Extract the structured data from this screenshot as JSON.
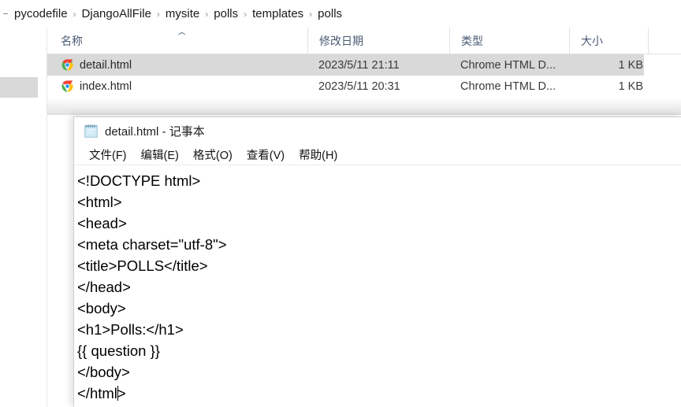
{
  "explorer": {
    "breadcrumb": {
      "separator": "›",
      "items": [
        {
          "label": "pycodefile"
        },
        {
          "label": "DjangoAllFile"
        },
        {
          "label": "mysite"
        },
        {
          "label": "polls"
        },
        {
          "label": "templates"
        },
        {
          "label": "polls"
        }
      ]
    },
    "columns": [
      {
        "key": "name",
        "label": "名称",
        "sort_indicator": "^"
      },
      {
        "key": "date",
        "label": "修改日期"
      },
      {
        "key": "type",
        "label": "类型"
      },
      {
        "key": "size",
        "label": "大小"
      }
    ],
    "files": [
      {
        "icon": "chrome-icon",
        "name": "detail.html",
        "date": "2023/5/11 21:11",
        "type": "Chrome HTML D...",
        "size": "1 KB",
        "selected": true
      },
      {
        "icon": "chrome-icon",
        "name": "index.html",
        "date": "2023/5/11 20:31",
        "type": "Chrome HTML D...",
        "size": "1 KB",
        "selected": false
      }
    ]
  },
  "notepad": {
    "icon": "notepad-icon",
    "title": "detail.html - 记事本",
    "menu": [
      {
        "label": "文件(F)"
      },
      {
        "label": "编辑(E)"
      },
      {
        "label": "格式(O)"
      },
      {
        "label": "查看(V)"
      },
      {
        "label": "帮助(H)"
      }
    ],
    "code_lines": [
      "<!DOCTYPE html>",
      "<html>",
      "<head>",
      "<meta charset=\"utf-8\">",
      "<title>POLLS</title>",
      "</head>",
      "<body>",
      "<h1>Polls:</h1>",
      "{{ question }}",
      "</body>",
      "</html>"
    ],
    "caret_line_index": 10,
    "caret_column": 6
  },
  "colors": {
    "selection_gray": "#d9d9d9",
    "header_text": "#4a5a73",
    "nav_highlight": "#d8d8d8"
  }
}
